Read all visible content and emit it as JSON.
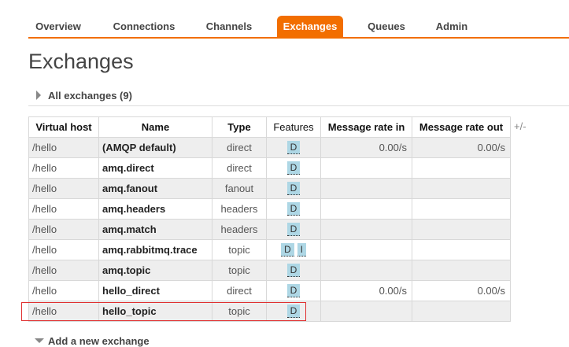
{
  "nav": {
    "tabs": [
      {
        "label": "Overview"
      },
      {
        "label": "Connections"
      },
      {
        "label": "Channels"
      },
      {
        "label": "Exchanges",
        "active": true
      },
      {
        "label": "Queues"
      },
      {
        "label": "Admin"
      }
    ],
    "accent_color": "#f26e00"
  },
  "page": {
    "title": "Exchanges",
    "section_label": "All exchanges (9)",
    "add_section_label": "Add a new exchange"
  },
  "table": {
    "columns": [
      "Virtual host",
      "Name",
      "Type",
      "Features",
      "Message rate in",
      "Message rate out"
    ],
    "column_toggle": "+/-",
    "rows": [
      {
        "vhost": "/hello",
        "name": "(AMQP default)",
        "type": "direct",
        "features": [
          "D"
        ],
        "rate_in": "0.00/s",
        "rate_out": "0.00/s"
      },
      {
        "vhost": "/hello",
        "name": "amq.direct",
        "type": "direct",
        "features": [
          "D"
        ],
        "rate_in": "",
        "rate_out": ""
      },
      {
        "vhost": "/hello",
        "name": "amq.fanout",
        "type": "fanout",
        "features": [
          "D"
        ],
        "rate_in": "",
        "rate_out": ""
      },
      {
        "vhost": "/hello",
        "name": "amq.headers",
        "type": "headers",
        "features": [
          "D"
        ],
        "rate_in": "",
        "rate_out": ""
      },
      {
        "vhost": "/hello",
        "name": "amq.match",
        "type": "headers",
        "features": [
          "D"
        ],
        "rate_in": "",
        "rate_out": ""
      },
      {
        "vhost": "/hello",
        "name": "amq.rabbitmq.trace",
        "type": "topic",
        "features": [
          "D",
          "I"
        ],
        "rate_in": "",
        "rate_out": ""
      },
      {
        "vhost": "/hello",
        "name": "amq.topic",
        "type": "topic",
        "features": [
          "D"
        ],
        "rate_in": "",
        "rate_out": ""
      },
      {
        "vhost": "/hello",
        "name": "hello_direct",
        "type": "direct",
        "features": [
          "D"
        ],
        "rate_in": "0.00/s",
        "rate_out": "0.00/s"
      },
      {
        "vhost": "/hello",
        "name": "hello_topic",
        "type": "topic",
        "features": [
          "D"
        ],
        "rate_in": "",
        "rate_out": ""
      }
    ],
    "highlighted_row": "hello_topic",
    "highlight_color": "#e03030",
    "badge_color": "#aed7e5"
  }
}
